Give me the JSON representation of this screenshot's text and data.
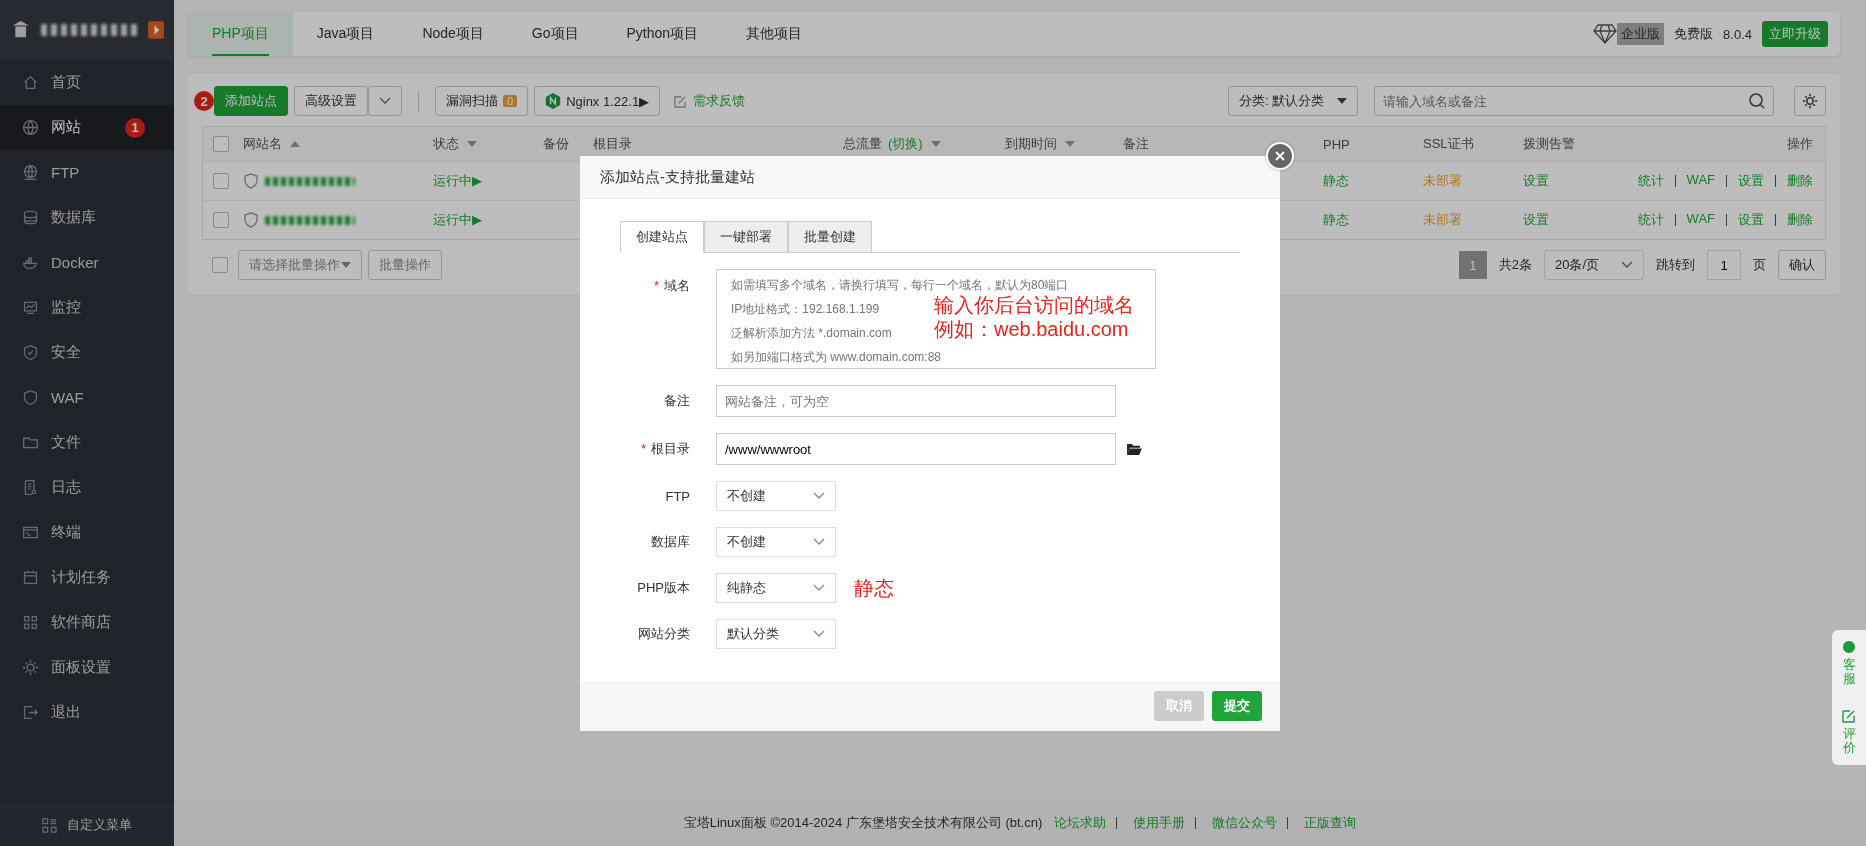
{
  "sidebar": {
    "items": [
      {
        "label": "首页",
        "selected": false
      },
      {
        "label": "网站",
        "selected": true,
        "badge": "1"
      },
      {
        "label": "FTP",
        "selected": false
      },
      {
        "label": "数据库",
        "selected": false
      },
      {
        "label": "Docker",
        "selected": false
      },
      {
        "label": "监控",
        "selected": false
      },
      {
        "label": "安全",
        "selected": false
      },
      {
        "label": "WAF",
        "selected": false
      },
      {
        "label": "文件",
        "selected": false
      },
      {
        "label": "日志",
        "selected": false
      },
      {
        "label": "终端",
        "selected": false
      },
      {
        "label": "计划任务",
        "selected": false
      },
      {
        "label": "软件商店",
        "selected": false
      },
      {
        "label": "面板设置",
        "selected": false
      },
      {
        "label": "退出",
        "selected": false
      }
    ],
    "footer": "自定义菜单"
  },
  "project_tabs": [
    {
      "label": "PHP项目",
      "selected": true
    },
    {
      "label": "Java项目",
      "selected": false
    },
    {
      "label": "Node项目",
      "selected": false
    },
    {
      "label": "Go项目",
      "selected": false
    },
    {
      "label": "Python项目",
      "selected": false
    },
    {
      "label": "其他项目",
      "selected": false
    }
  ],
  "edition": {
    "enterprise": "企业版",
    "free": "免费版",
    "version": "8.0.4",
    "upgrade": "立即升级"
  },
  "toolbar": {
    "step_badge": "2",
    "add_site": "添加站点",
    "advanced": "高级设置",
    "scan": "漏洞扫描",
    "scan_count": "0",
    "nginx": "Nginx 1.22.1▶",
    "feedback": "需求反馈",
    "category": "分类: 默认分类",
    "search_placeholder": "请输入域名或备注"
  },
  "table": {
    "select_all_checked": false,
    "columns": [
      "网站名",
      "状态",
      "备份",
      "根目录",
      "总流量",
      "到期时间",
      "备注",
      "PHP",
      "SSL证书",
      "拨测告警",
      "操作"
    ],
    "traffic_switch": "(切换)",
    "rows": [
      {
        "checked": false,
        "status": "运行中▶",
        "php": "静态",
        "ssl": "未部署",
        "monitor": "设置",
        "actions": [
          "统计",
          "WAF",
          "设置",
          "删除"
        ]
      },
      {
        "checked": false,
        "status": "运行中▶",
        "php": "静态",
        "ssl": "未部署",
        "monitor": "设置",
        "actions": [
          "统计",
          "WAF",
          "设置",
          "删除"
        ]
      }
    ]
  },
  "batch": {
    "checked": false,
    "placeholder": "请选择批量操作",
    "button": "批量操作"
  },
  "pagination": {
    "page": "1",
    "total": "共2条",
    "per_page": "20条/页",
    "goto": "跳转到",
    "goto_value": "1",
    "page_unit": "页",
    "confirm": "确认"
  },
  "modal": {
    "title": "添加站点-支持批量建站",
    "required_mark": "*",
    "tabs": [
      {
        "label": "创建站点",
        "selected": true
      },
      {
        "label": "一键部署",
        "selected": false
      },
      {
        "label": "批量创建",
        "selected": false
      }
    ],
    "fields": [
      {
        "kind": "textarea",
        "label": "域名",
        "required": true,
        "placeholder": "如需填写多个域名，请换行填写，每行一个域名，默认为80端口\nIP地址格式：192.168.1.199\n泛解析添加方法 *.domain.com\n如另加端口格式为 www.domain.com:88",
        "notes": [
          "输入你后台访问的域名",
          "例如：web.baidu.com"
        ]
      },
      {
        "kind": "input",
        "label": "备注",
        "required": false,
        "placeholder": "网站备注，可为空"
      },
      {
        "kind": "path",
        "label": "根目录",
        "required": true,
        "value": "/www/wwwroot"
      },
      {
        "kind": "select",
        "label": "FTP",
        "required": false,
        "value": "不创建"
      },
      {
        "kind": "select",
        "label": "数据库",
        "required": false,
        "value": "不创建"
      },
      {
        "kind": "select",
        "label": "PHP版本",
        "required": false,
        "value": "纯静态",
        "note": "静态"
      },
      {
        "kind": "select",
        "label": "网站分类",
        "required": false,
        "value": "默认分类"
      }
    ],
    "cancel": "取消",
    "submit": "提交"
  },
  "footer": {
    "copyright": "宝塔Linux面板 ©2014-2024 广东堡塔安全技术有限公司 (bt.cn)",
    "links": [
      "论坛求助",
      "使用手册",
      "微信公众号",
      "正版查询"
    ]
  },
  "float": [
    "客服",
    "评价"
  ]
}
